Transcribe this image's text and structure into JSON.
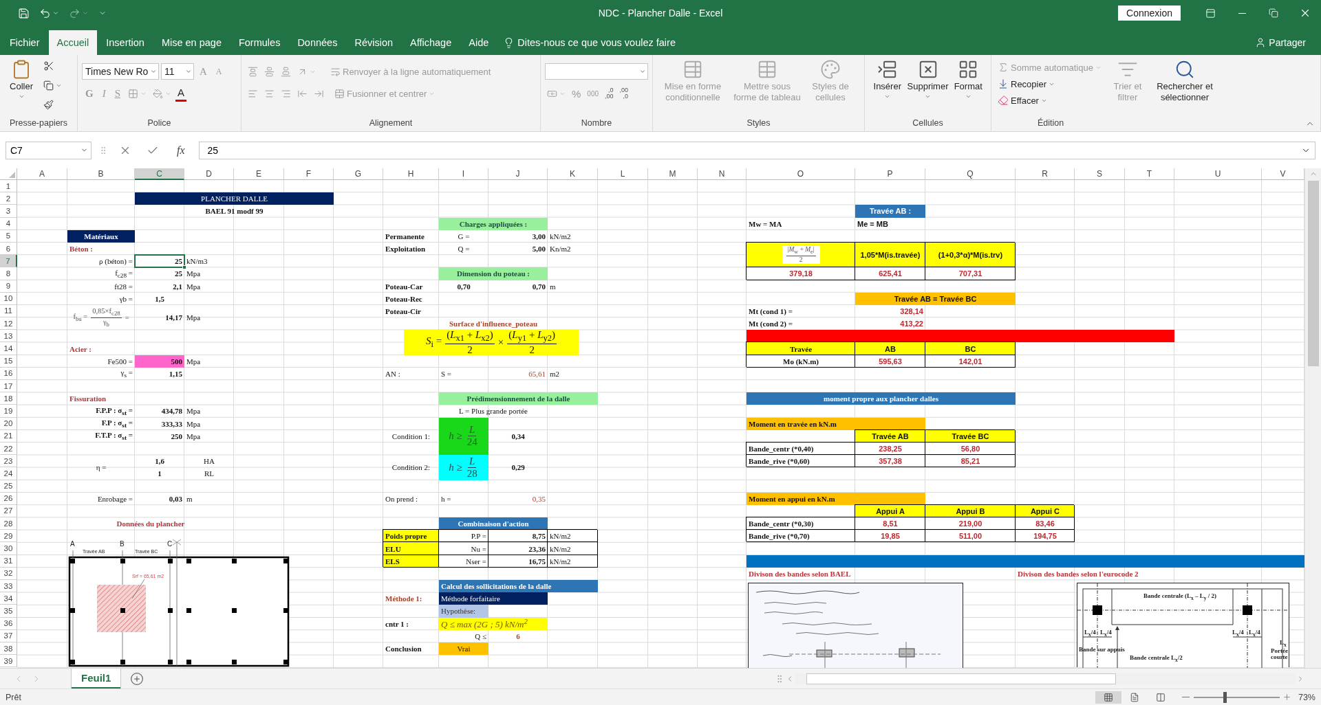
{
  "window": {
    "title": "NDC - Plancher Dalle  -  Excel",
    "account_button": "Connexion"
  },
  "menu_tabs": [
    {
      "label": "Fichier",
      "selected": false
    },
    {
      "label": "Accueil",
      "selected": true
    },
    {
      "label": "Insertion",
      "selected": false
    },
    {
      "label": "Mise en page",
      "selected": false
    },
    {
      "label": "Formules",
      "selected": false
    },
    {
      "label": "Données",
      "selected": false
    },
    {
      "label": "Révision",
      "selected": false
    },
    {
      "label": "Affichage",
      "selected": false
    },
    {
      "label": "Aide",
      "selected": false
    }
  ],
  "tell_me": "Dites-nous ce que vous voulez faire",
  "share": "Partager",
  "ribbon": {
    "clipboard": {
      "label": "Presse-papiers",
      "paste": "Coller"
    },
    "font": {
      "label": "Police",
      "name": "Times New Ro",
      "size": "11",
      "grow": "A",
      "shrink": "A",
      "styles": [
        {
          "label": "G",
          "kind": "bold",
          "disabled": true
        },
        {
          "label": "I",
          "kind": "italic",
          "disabled": true
        },
        {
          "label": "S",
          "kind": "underline",
          "disabled": true
        }
      ],
      "color_button": "A"
    },
    "alignment": {
      "label": "Alignement",
      "buttons": [
        {
          "label": "Renvoyer à la ligne automatiquement",
          "disabled": true
        },
        {
          "label": "Fusionner et centrer",
          "disabled": true
        }
      ]
    },
    "number": {
      "label": "Nombre",
      "percent": "%",
      "thousands": "000",
      "more_decimals": [
        ",0",
        ",00"
      ],
      "fewer_decimals": [
        ",00",
        ",0"
      ]
    },
    "styles": {
      "label": "Styles",
      "buttons": [
        {
          "label": "Mise en forme conditionnelle",
          "disabled": true
        },
        {
          "label": "Mettre sous forme de tableau",
          "disabled": true
        },
        {
          "label": "Styles de cellules",
          "disabled": true
        }
      ]
    },
    "cells": {
      "label": "Cellules",
      "buttons": [
        {
          "label": "Insérer",
          "disabled": false
        },
        {
          "label": "Supprimer",
          "disabled": false
        },
        {
          "label": "Format",
          "disabled": false
        }
      ]
    },
    "editing": {
      "label": "Édition",
      "small": [
        {
          "label": "Somme automatique",
          "disabled": true
        },
        {
          "label": "Recopier",
          "disabled": false
        },
        {
          "label": "Effacer",
          "disabled": false
        }
      ],
      "large": [
        {
          "label": "Trier et filtrer",
          "disabled": true
        },
        {
          "label": "Rechercher et sélectionner",
          "disabled": false
        }
      ]
    }
  },
  "formula_bar": {
    "name_box": "C7",
    "fx": "fx",
    "value": "25"
  },
  "columns": [
    {
      "label": "A",
      "selected": false
    },
    {
      "label": "B",
      "selected": false
    },
    {
      "label": "C",
      "selected": true
    },
    {
      "label": "D",
      "selected": false
    },
    {
      "label": "E",
      "selected": false
    },
    {
      "label": "F",
      "selected": false
    },
    {
      "label": "G",
      "selected": false
    },
    {
      "label": "H",
      "selected": false
    },
    {
      "label": "I",
      "selected": false
    },
    {
      "label": "J",
      "selected": false
    },
    {
      "label": "K",
      "selected": false
    },
    {
      "label": "L",
      "selected": false
    },
    {
      "label": "M",
      "selected": false
    },
    {
      "label": "N",
      "selected": false
    },
    {
      "label": "O",
      "selected": false
    },
    {
      "label": "P",
      "selected": false
    },
    {
      "label": "Q",
      "selected": false
    },
    {
      "label": "R",
      "selected": false
    },
    {
      "label": "S",
      "selected": false
    },
    {
      "label": "T",
      "selected": false
    },
    {
      "label": "U",
      "selected": false
    },
    {
      "label": "V",
      "selected": false
    }
  ],
  "rows": [
    {
      "label": "1",
      "selected": false
    },
    {
      "label": "2",
      "selected": false
    },
    {
      "label": "3",
      "selected": false
    },
    {
      "label": "4",
      "selected": false
    },
    {
      "label": "5",
      "selected": false
    },
    {
      "label": "6",
      "selected": false
    },
    {
      "label": "7",
      "selected": true
    },
    {
      "label": "8",
      "selected": false
    },
    {
      "label": "9",
      "selected": false
    },
    {
      "label": "10",
      "selected": false
    },
    {
      "label": "11",
      "selected": false
    },
    {
      "label": "12",
      "selected": false
    },
    {
      "label": "13",
      "selected": false
    },
    {
      "label": "14",
      "selected": false
    },
    {
      "label": "15",
      "selected": false
    },
    {
      "label": "16",
      "selected": false
    },
    {
      "label": "17",
      "selected": false
    },
    {
      "label": "18",
      "selected": false
    },
    {
      "label": "19",
      "selected": false
    },
    {
      "label": "20",
      "selected": false
    },
    {
      "label": "21",
      "selected": false
    },
    {
      "label": "22",
      "selected": false
    },
    {
      "label": "23",
      "selected": false
    },
    {
      "label": "24",
      "selected": false
    },
    {
      "label": "25",
      "selected": false
    },
    {
      "label": "26",
      "selected": false
    },
    {
      "label": "27",
      "selected": false
    },
    {
      "label": "28",
      "selected": false
    },
    {
      "label": "29",
      "selected": false
    },
    {
      "label": "30",
      "selected": false
    },
    {
      "label": "31",
      "selected": false
    },
    {
      "label": "32",
      "selected": false
    },
    {
      "label": "33",
      "selected": false
    },
    {
      "label": "34",
      "selected": false
    },
    {
      "label": "35",
      "selected": false
    },
    {
      "label": "36",
      "selected": false
    },
    {
      "label": "37",
      "selected": false
    },
    {
      "label": "38",
      "selected": false
    },
    {
      "label": "39",
      "selected": false
    }
  ],
  "title_block": [
    {
      "text": "PLANCHER DALLE",
      "kind": "banner"
    },
    {
      "text": "BAEL 91 modf 99",
      "kind": "title"
    }
  ],
  "materials": [
    {
      "text": "Matériaux",
      "kind": "banner-b"
    },
    {
      "text": "Béton :",
      "kind": "heading"
    },
    {
      "text": "ρ (béton) =",
      "kind": "label-r"
    },
    {
      "text": "25",
      "kind": "value"
    },
    {
      "text": "kN/m3",
      "kind": "unit"
    },
    {
      "text": "f$_{c28}$ =",
      "kind": "label-r"
    },
    {
      "text": "25",
      "kind": "value"
    },
    {
      "text": "Mpa",
      "kind": "unit"
    },
    {
      "text": "ft28 =",
      "kind": "label-r"
    },
    {
      "text": "2,1",
      "kind": "value"
    },
    {
      "text": "Mpa",
      "kind": "unit"
    },
    {
      "text": "γb =",
      "kind": "label-r"
    },
    {
      "text": "1,5",
      "kind": "value-c"
    },
    {
      "kind": "formula-fbu",
      "parts": [
        {
          "text": "f$_{bu}$ ="
        },
        {
          "num": "0,85×f$_{c28}$",
          "den": "γ$_{b}$"
        },
        {
          "text": "="
        }
      ]
    },
    {
      "text": "14,17",
      "kind": "value"
    },
    {
      "text": "Mpa",
      "kind": "unit"
    },
    {
      "text": "Acier :",
      "kind": "heading"
    },
    {
      "text": "Fe500 =",
      "kind": "label-r"
    },
    {
      "text": "500",
      "kind": "pink"
    },
    {
      "text": "Mpa",
      "kind": "unit"
    },
    {
      "text": "γ$_{s}$ =",
      "kind": "label-r"
    },
    {
      "text": "1,15",
      "kind": "value"
    },
    {
      "text": "Fissuration",
      "kind": "heading"
    },
    {
      "text": "F.P.P : σ$_{st}$ =",
      "kind": "label-rb"
    },
    {
      "text": "434,78",
      "kind": "value"
    },
    {
      "text": "Mpa",
      "kind": "unit"
    },
    {
      "text": "F.P : σ$_{st}$ =",
      "kind": "label-rb"
    },
    {
      "text": "333,33",
      "kind": "value"
    },
    {
      "text": "Mpa",
      "kind": "unit"
    },
    {
      "text": "F.T.P : σ$_{st}$ =",
      "kind": "label-rb"
    },
    {
      "text": "250",
      "kind": "value"
    },
    {
      "text": "Mpa",
      "kind": "unit"
    },
    {
      "text": "η =",
      "kind": "label-c"
    },
    {
      "text": "1,6",
      "kind": "value-c"
    },
    {
      "text": "HA",
      "kind": "unit-c"
    },
    {
      "text": "1",
      "kind": "value-c"
    },
    {
      "text": "RL",
      "kind": "unit-c"
    },
    {
      "text": "Enrobage =",
      "kind": "label-r"
    },
    {
      "text": "0,03",
      "kind": "value"
    },
    {
      "text": "m",
      "kind": "unit"
    },
    {
      "text": "Données du plancher",
      "kind": "heading-c"
    }
  ],
  "plan": {
    "axes": [
      "A",
      "B",
      "C"
    ],
    "spans": [
      "Travée AB",
      "Travée BC"
    ],
    "area_label": "Srf = 65,61 m2"
  },
  "loads": [
    {
      "text": "Charges appliquées :",
      "kind": "band-green"
    },
    {
      "text": "Permanente",
      "kind": "label-b"
    },
    {
      "text": "G =",
      "kind": "label-c"
    },
    {
      "text": "3,00",
      "kind": "value"
    },
    {
      "text": "kN/m2",
      "kind": "unit"
    },
    {
      "text": "Exploitation",
      "kind": "label-b"
    },
    {
      "text": "Q =",
      "kind": "label-c"
    },
    {
      "text": "5,00",
      "kind": "value"
    },
    {
      "text": "Kn/m2",
      "kind": "unit"
    },
    {
      "text": "Dimension du poteau :",
      "kind": "band-green"
    },
    {
      "text": "Poteau-Car",
      "kind": "label-b"
    },
    {
      "text": "0,70",
      "kind": "value-c"
    },
    {
      "text": "0,70",
      "kind": "value"
    },
    {
      "text": "m",
      "kind": "unit"
    },
    {
      "text": "Poteau-Rec",
      "kind": "label-b"
    },
    {
      "text": "Poteau-Cir",
      "kind": "label-b"
    },
    {
      "text": "Surface d'influence_poteau",
      "kind": "heading-rust-c"
    },
    {
      "kind": "formula-si",
      "parts": [
        {
          "text": "*S*$_{i}$ ="
        },
        {
          "num": "(*L*$_{x1}$ + *L*$_{x2}$)",
          "den": "2"
        },
        {
          "text": "×"
        },
        {
          "num": "(*L*$_{y1}$ + *L*$_{y2}$)",
          "den": "2"
        }
      ]
    },
    {
      "text": "AN :",
      "kind": "label"
    },
    {
      "text": "S =",
      "kind": "label"
    },
    {
      "text": "65,61",
      "kind": "red-r"
    },
    {
      "text": "m2",
      "kind": "unit"
    },
    {
      "text": "Prédimensionnement de la dalle",
      "kind": "band-green"
    },
    {
      "text": "L = Plus grande portée",
      "kind": "label-c"
    },
    {
      "text": "Condition 1:",
      "kind": "label-c"
    },
    {
      "kind": "formula-green",
      "parts": [
        {
          "text": "*h* ≥"
        },
        {
          "num": "*L*",
          "den": "24"
        }
      ]
    },
    {
      "text": "0,34",
      "kind": "value-c"
    },
    {
      "text": "Condition 2:",
      "kind": "label-c"
    },
    {
      "kind": "formula-cyan",
      "parts": [
        {
          "text": "*h* ≥"
        },
        {
          "num": "*L*",
          "den": "28"
        }
      ]
    },
    {
      "text": "0,29",
      "kind": "value-c"
    },
    {
      "text": "On prend :",
      "kind": "label"
    },
    {
      "text": "h =",
      "kind": "label"
    },
    {
      "text": "0,35",
      "kind": "red-r"
    },
    {
      "text": "Combinaison d'action",
      "kind": "band-blue"
    },
    {
      "text": "Poids propre",
      "kind": "yellow-l"
    },
    {
      "text": "P.P =",
      "kind": "label-r"
    },
    {
      "text": "8,75",
      "kind": "value"
    },
    {
      "text": "kN/m2",
      "kind": "unit"
    },
    {
      "text": "ELU",
      "kind": "yellow-l"
    },
    {
      "text": "Nu =",
      "kind": "label-r"
    },
    {
      "text": "23,36",
      "kind": "value"
    },
    {
      "text": "kN/m2",
      "kind": "unit"
    },
    {
      "text": "ELS",
      "kind": "yellow-l"
    },
    {
      "text": "Nser =",
      "kind": "label-r"
    },
    {
      "text": "16,75",
      "kind": "value"
    },
    {
      "text": "kN/m2",
      "kind": "unit"
    },
    {
      "text": "Calcul des sollicitations de la dalle",
      "kind": "band-blue-l"
    },
    {
      "text": "Méthode 1:",
      "kind": "heading-rust"
    },
    {
      "text": "Méthode forfaitaire",
      "kind": "band-navy"
    },
    {
      "text": "Hypothèse:",
      "kind": "band-lightblue"
    },
    {
      "text": "cntr 1 :",
      "kind": "label-b"
    },
    {
      "kind": "formula-cntr",
      "parts": [
        {
          "text": "Q ≤ max (2G ; 5) kN/m$^{2}$"
        }
      ]
    },
    {
      "text": "Q ≤",
      "kind": "label-r"
    },
    {
      "text": "6",
      "kind": "red-cserif"
    },
    {
      "text": "Conclusion",
      "kind": "label-b"
    },
    {
      "text": "Vrai",
      "kind": "orange-c"
    }
  ],
  "moments": [
    {
      "text": "Travée AB :",
      "kind": "band-blue-s"
    },
    {
      "text": "Mw = MA",
      "kind": "label-b"
    },
    {
      "text": "Me = MB",
      "kind": "label-bs"
    },
    {
      "kind": "formula-card",
      "parts": [
        {
          "num": "|*M*$_{w}$ + *M*$_{e}$|",
          "den": "2"
        }
      ]
    },
    {
      "text": "1,05*M(is.travée)",
      "kind": "yellow-c"
    },
    {
      "text": "(1+0,3*α)*M(is.trv)",
      "kind": "yellow-c"
    },
    {
      "text": "379,18",
      "kind": "red-c"
    },
    {
      "text": "625,41",
      "kind": "red-c"
    },
    {
      "text": "707,31",
      "kind": "red-c"
    },
    {
      "text": "Travée AB = Travée BC",
      "kind": "orange-cs"
    },
    {
      "text": "Mt (cond 1) =",
      "kind": "label-b"
    },
    {
      "text": "328,14",
      "kind": "red-rs"
    },
    {
      "text": "Mt (cond 2) =",
      "kind": "label-b"
    },
    {
      "text": "413,22",
      "kind": "red-rs"
    },
    {
      "text": "Travée",
      "kind": "yellow-cserif"
    },
    {
      "text": "AB",
      "kind": "yellow-c"
    },
    {
      "text": "BC",
      "kind": "yellow-c"
    },
    {
      "text": "Mo (kN.m)",
      "kind": "label-bc"
    },
    {
      "text": "595,63",
      "kind": "red-c"
    },
    {
      "text": "142,01",
      "kind": "red-c"
    },
    {
      "text": "moment propre aux plancher dalles",
      "kind": "band-blue"
    },
    {
      "text": "Moment en travée en kN.m",
      "kind": "orange-l"
    },
    {
      "text": "Travée AB",
      "kind": "yellow-c"
    },
    {
      "text": "Travée BC",
      "kind": "yellow-c"
    },
    {
      "text": "Bande_centr (*0,40)",
      "kind": "label-b"
    },
    {
      "text": "238,25",
      "kind": "red-c"
    },
    {
      "text": "56,80",
      "kind": "red-c"
    },
    {
      "text": "Bande_rive (*0,60)",
      "kind": "label-b"
    },
    {
      "text": "357,38",
      "kind": "red-c"
    },
    {
      "text": "85,21",
      "kind": "red-c"
    },
    {
      "text": "Moment en appui en kN.m",
      "kind": "orange-l"
    },
    {
      "text": "Appui A",
      "kind": "yellow-c"
    },
    {
      "text": "Appui B",
      "kind": "yellow-c"
    },
    {
      "text": "Appui C",
      "kind": "yellow-c"
    },
    {
      "text": "Bande_centr (*0,30)",
      "kind": "label-b"
    },
    {
      "text": "8,51",
      "kind": "red-c"
    },
    {
      "text": "219,00",
      "kind": "red-c"
    },
    {
      "text": "83,46",
      "kind": "red-c"
    },
    {
      "text": "Bande_rive (*0,70)",
      "kind": "label-b"
    },
    {
      "text": "19,85",
      "kind": "red-c"
    },
    {
      "text": "511,00",
      "kind": "red-c"
    },
    {
      "text": "194,75",
      "kind": "red-c"
    },
    {
      "text": "Divison des bandes selon BAEL",
      "kind": "heading"
    },
    {
      "text": "Divison des bandes selon l'eurocode 2",
      "kind": "heading"
    }
  ],
  "eurocode_diagram": {
    "labels": [
      "Bande centrale (L$_{x}$ – L$_{y}$ / 2)",
      "L$_{x}$/4",
      "L$_{x}$/4",
      "L$_{x}$/4",
      "L$_{x}$/4",
      "Bande sur appuis",
      "Bande centrale L$_{x}$/2",
      "L$_{x}$",
      "Portée courte"
    ]
  },
  "sheet_tabs": [
    {
      "label": "Feuil1",
      "selected": true
    }
  ],
  "status_bar": {
    "status": "Prêt",
    "zoom": {
      "level": 0.36,
      "reading": "73%"
    }
  }
}
